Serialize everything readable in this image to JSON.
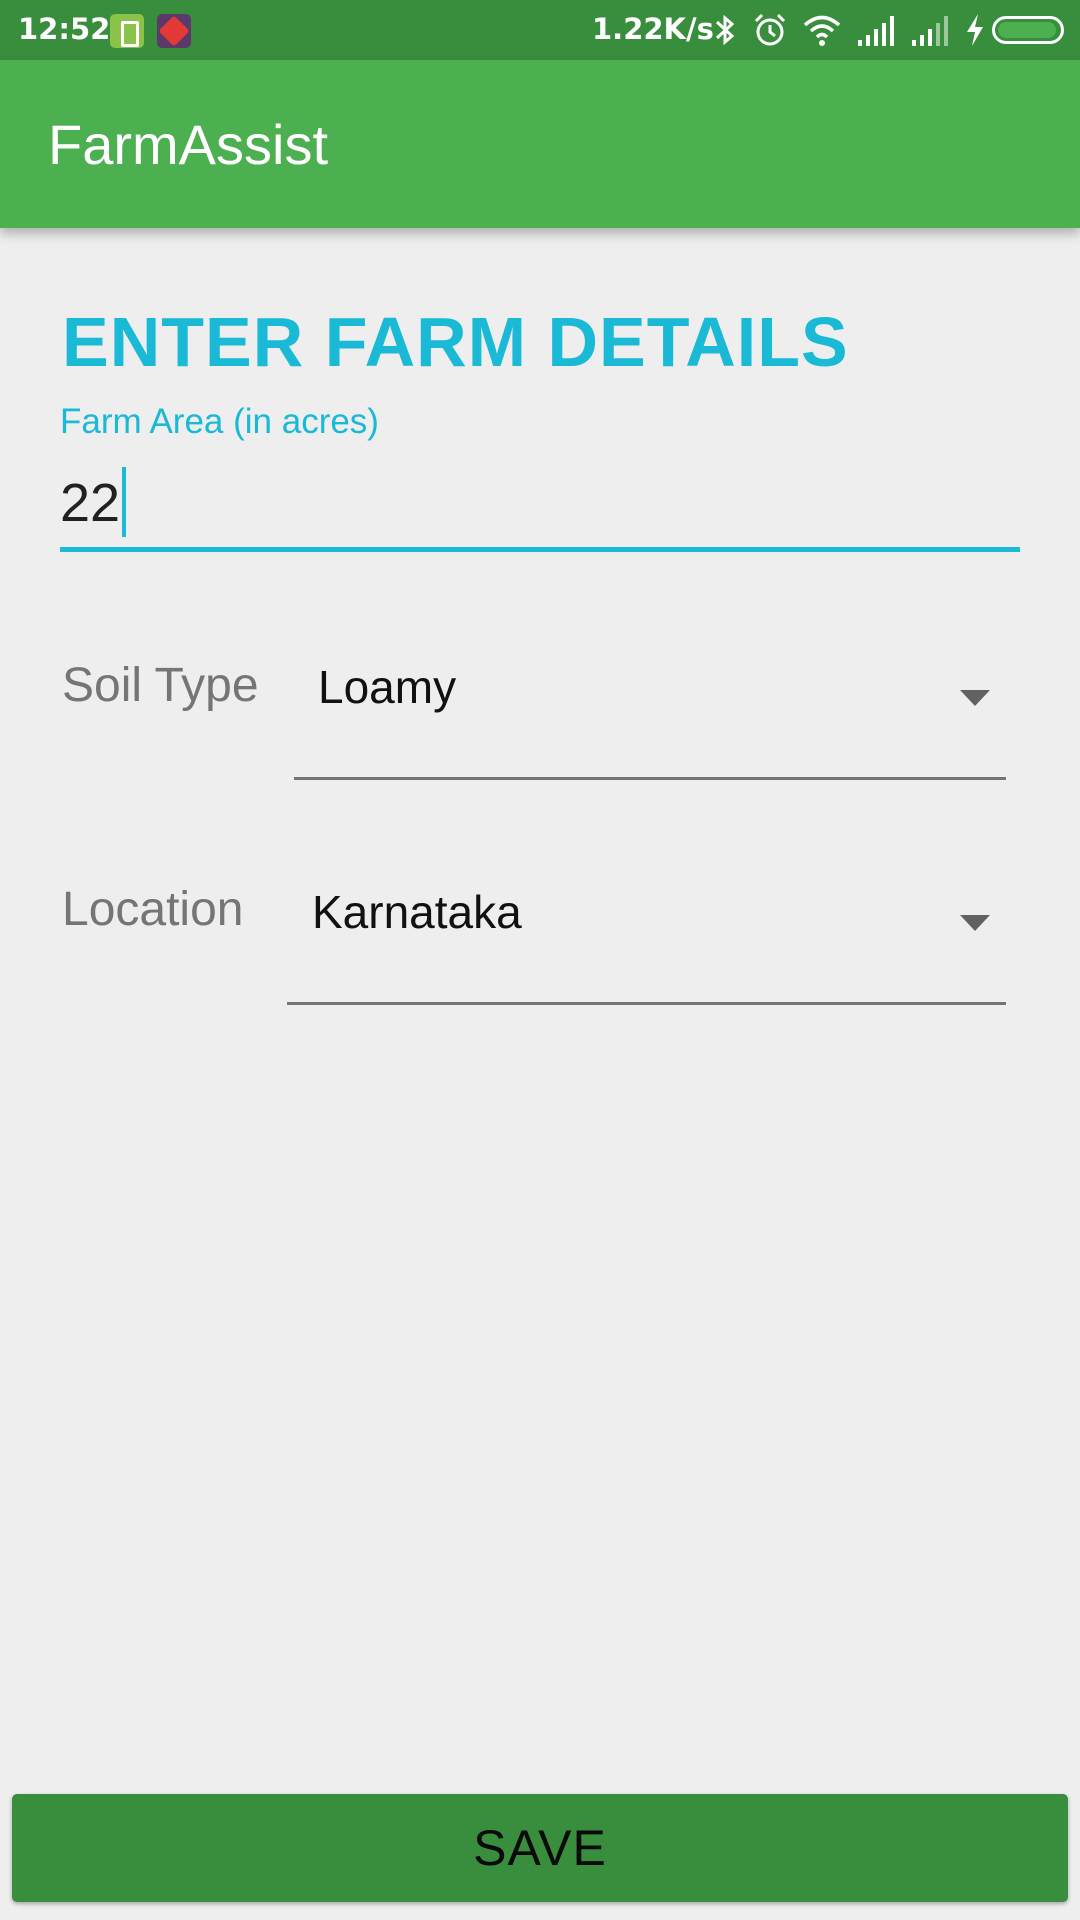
{
  "status_bar": {
    "time": "12:52",
    "net_speed": "1.22K/s"
  },
  "app": {
    "title": "FarmAssist"
  },
  "form": {
    "heading": "ENTER FARM DETAILS",
    "area_label": "Farm Area (in acres)",
    "area_value": "22",
    "soil_label": "Soil Type",
    "soil_value": "Loamy",
    "location_label": "Location",
    "location_value": "Karnataka"
  },
  "actions": {
    "save_label": "SAVE"
  },
  "colors": {
    "status_bar": "#388e3c",
    "app_bar": "#4caf50",
    "accent": "#1ab9d6",
    "save_button": "#388e3c",
    "background": "#eeeeee"
  }
}
